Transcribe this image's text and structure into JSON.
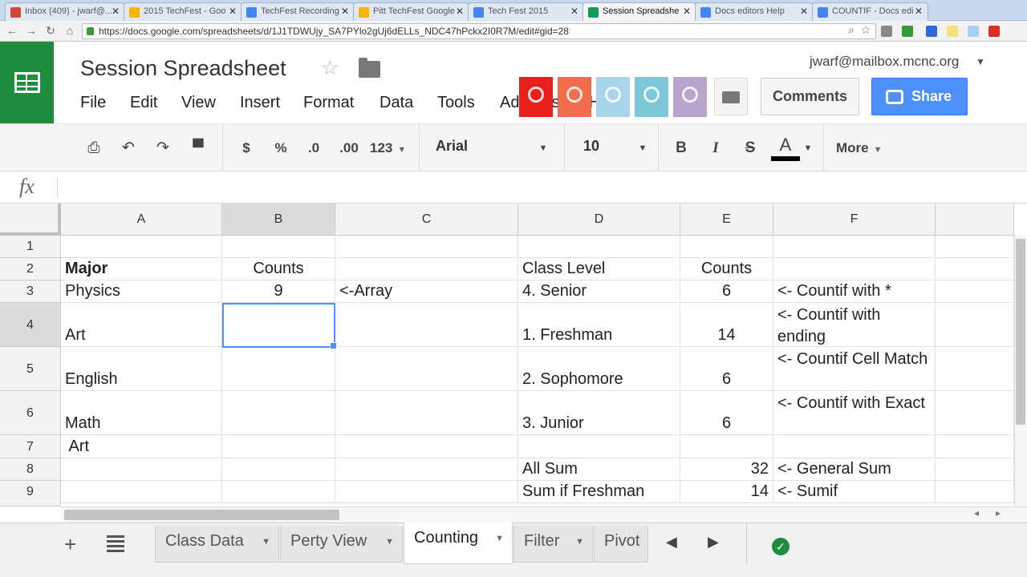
{
  "browser_tabs": [
    {
      "title": "Inbox (409) - jwarf@...",
      "icon_color": "#d44638"
    },
    {
      "title": "2015 TechFest - Goo",
      "icon_color": "#f4b400"
    },
    {
      "title": "TechFest Recording",
      "icon_color": "#4285f4"
    },
    {
      "title": "Pitt TechFest Google",
      "icon_color": "#f4b400"
    },
    {
      "title": "Tech Fest 2015",
      "icon_color": "#4285f4"
    },
    {
      "title": "Session Spreadshe",
      "icon_color": "#0f9d58"
    },
    {
      "title": "Docs editors Help",
      "icon_color": "#4285f4"
    },
    {
      "title": "COUNTIF - Docs edi",
      "icon_color": "#4285f4"
    }
  ],
  "address": {
    "url": "https://docs.google.com/spreadsheets/d/1J1TDWUjy_SA7PYlo2gUj6dELLs_NDC47hPckx2I0R7M/edit#gid=28"
  },
  "doc": {
    "title": "Session Spreadsheet",
    "user": "jwarf@mailbox.mcnc.org",
    "menu": [
      "File",
      "Edit",
      "View",
      "Insert",
      "Format",
      "Data",
      "Tools",
      "Add-ons",
      "Help"
    ],
    "comments_label": "Comments",
    "share_label": "Share",
    "avatar_colors": [
      "#e8201c",
      "#f26b4a",
      "#a8d4ec",
      "#7cc8d8",
      "#b8a4cc"
    ]
  },
  "toolbar": {
    "currency": "$",
    "percent": "%",
    "dec_decrease": ".0",
    "dec_increase": ".00",
    "number_format": "123",
    "font": "Arial",
    "font_size": "10",
    "bold": "B",
    "italic": "I",
    "strike": "S",
    "text_color": "A",
    "more": "More"
  },
  "formula_bar": {
    "label": "fx",
    "value": ""
  },
  "grid": {
    "columns": [
      "A",
      "B",
      "C",
      "D",
      "E",
      "F"
    ],
    "rows": [
      "1",
      "2",
      "3",
      "4",
      "5",
      "6",
      "7",
      "8",
      "9"
    ],
    "cells": {
      "A2": "Major",
      "B2": "Counts",
      "D2": "Class Level",
      "E2": "Counts",
      "A3": "Physics",
      "B3": "9",
      "C3": "<-Array",
      "D3": "4. Senior",
      "E3": "6",
      "F3": "<- Countif with *",
      "A4": "Art",
      "D4": "1. Freshman",
      "E4": "14",
      "F4": "<- Countif with ending",
      "A5": "English",
      "D5": "2. Sophomore",
      "E5": "6",
      "F5": "<- Countif Cell Match",
      "A6": "Math",
      "D6": "3. Junior",
      "E6": "6",
      "F6": "<- Countif with Exact",
      "A7": " Art",
      "D8": "All Sum",
      "E8": "32",
      "F8": "<- General Sum",
      "D9": "Sum if Freshman",
      "E9": "14",
      "F9": "<- Sumif"
    },
    "selected_cell": "B4"
  },
  "sheets": [
    {
      "name": "Class Data",
      "active": false
    },
    {
      "name": "Perty View",
      "active": false
    },
    {
      "name": "Counting",
      "active": true
    },
    {
      "name": "Filter",
      "active": false
    },
    {
      "name": "Pivot",
      "active": false
    }
  ]
}
